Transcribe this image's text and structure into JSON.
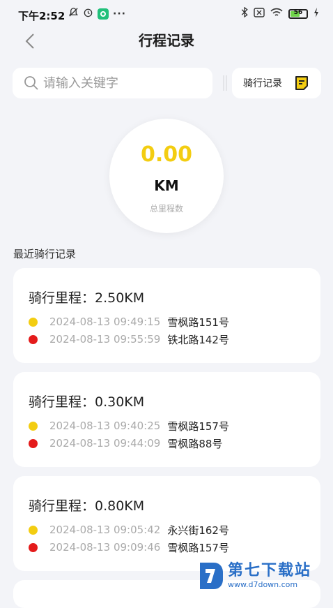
{
  "status_bar": {
    "time": "下午2:52",
    "dots": "···",
    "battery": "56"
  },
  "header": {
    "title": "行程记录"
  },
  "search": {
    "placeholder": "请输入关键字",
    "record_button": "骑行记录"
  },
  "summary": {
    "value": "0.00",
    "unit": "KM",
    "caption": "总里程数"
  },
  "section_title": "最近骑行记录",
  "trips": [
    {
      "title": "骑行里程：2.50KM",
      "start_time": "2024-08-13 09:49:15",
      "start_place": "雪枫路151号",
      "end_time": "2024-08-13 09:55:59",
      "end_place": "铁北路142号"
    },
    {
      "title": "骑行里程：0.30KM",
      "start_time": "2024-08-13 09:40:25",
      "start_place": "雪枫路157号",
      "end_time": "2024-08-13 09:44:09",
      "end_place": "雪枫路88号"
    },
    {
      "title": "骑行里程：0.80KM",
      "start_time": "2024-08-13 09:05:42",
      "start_place": "永兴街162号",
      "end_time": "2024-08-13 09:09:46",
      "end_place": "雪枫路157号"
    }
  ],
  "watermark": {
    "name": "第七下载站",
    "url": "www.d7down.com"
  },
  "colors": {
    "accent_yellow": "#f3cd11",
    "end_red": "#e41b1b",
    "background": "#f3f4f8"
  }
}
